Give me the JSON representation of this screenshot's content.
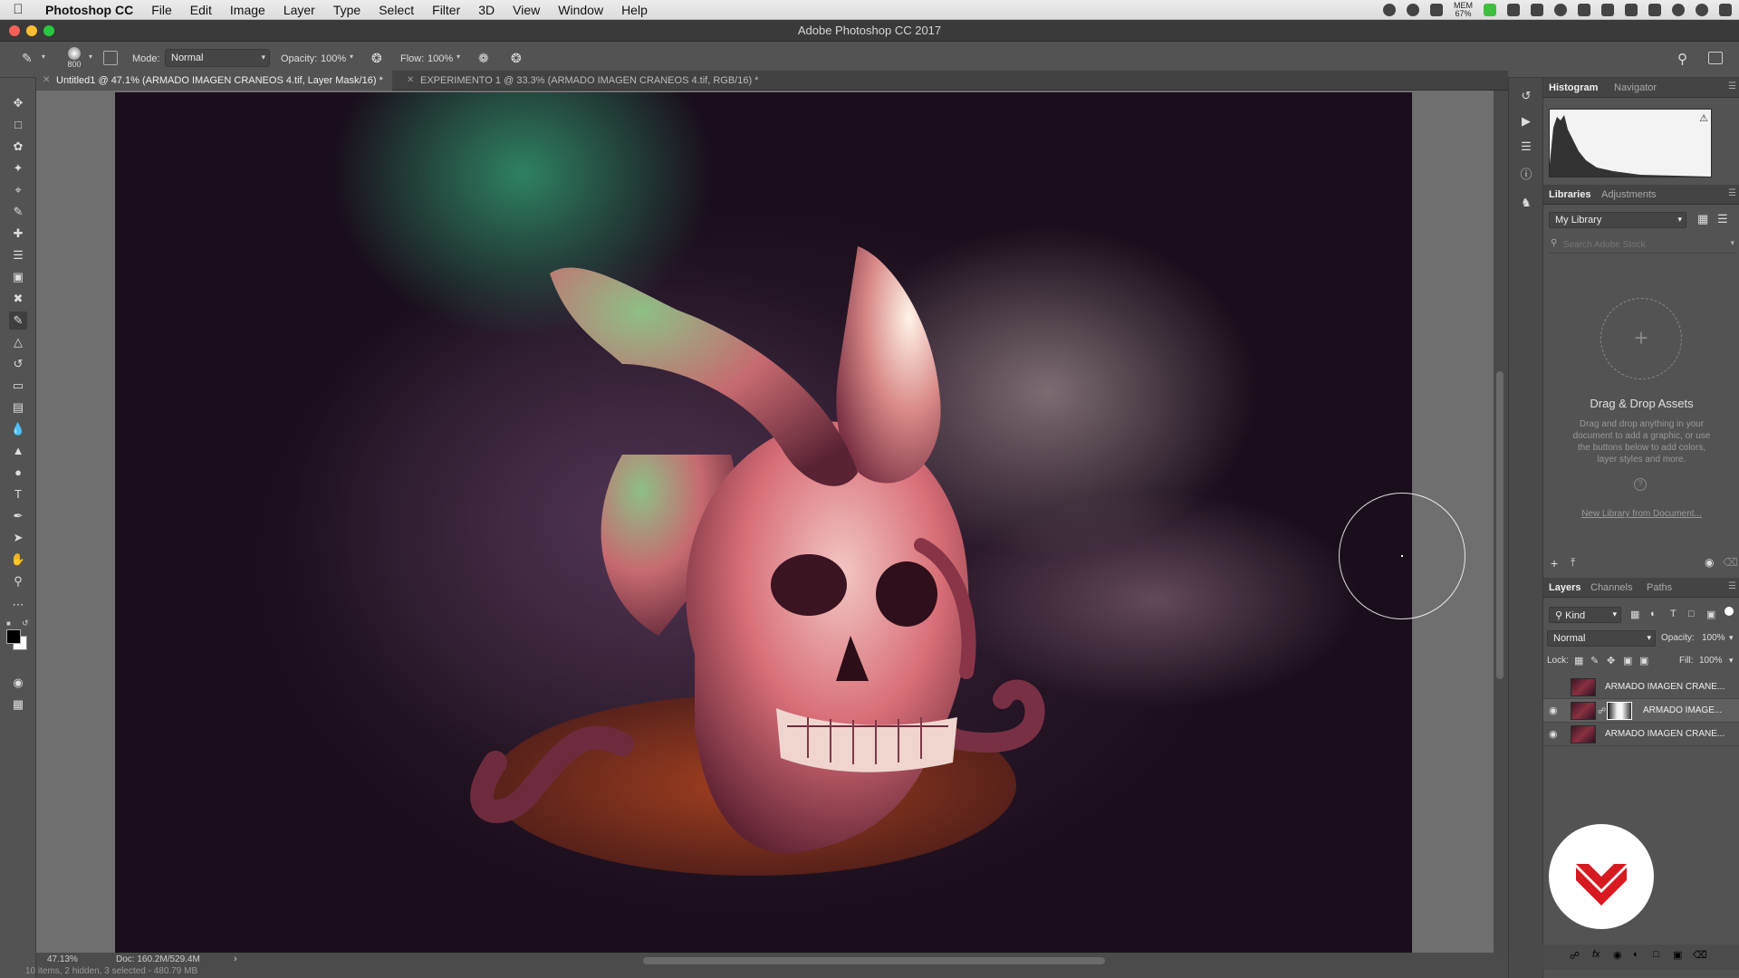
{
  "menubar": {
    "app_name": "Photoshop CC",
    "items": [
      "File",
      "Edit",
      "Image",
      "Layer",
      "Type",
      "Select",
      "Filter",
      "3D",
      "View",
      "Window",
      "Help"
    ],
    "mem_label": "MEM",
    "mem_value": "67%"
  },
  "window": {
    "title": "Adobe Photoshop CC 2017"
  },
  "options": {
    "brush_size": "800",
    "mode_label": "Mode:",
    "mode_value": "Normal",
    "opacity_label": "Opacity:",
    "opacity_value": "100%",
    "flow_label": "Flow:",
    "flow_value": "100%"
  },
  "tabs": [
    {
      "label": "Untitled1 @ 47.1% (ARMADO IMAGEN CRANEOS 4.tif, Layer Mask/16) *",
      "active": true
    },
    {
      "label": "EXPERIMENTO 1 @ 33.3% (ARMADO IMAGEN CRANEOS 4.tif, RGB/16) *",
      "active": false
    }
  ],
  "status": {
    "zoom": "47.13%",
    "doc": "Doc: 160.2M/529.4M",
    "items": "10 items, 2 hidden, 3 selected - 480.79 MB"
  },
  "histogram_panel": {
    "tabs": [
      "Histogram",
      "Navigator"
    ]
  },
  "libraries_panel": {
    "tabs": [
      "Libraries",
      "Adjustments"
    ],
    "library_select": "My Library",
    "search_placeholder": "Search Adobe Stock",
    "drop_title": "Drag & Drop Assets",
    "drop_text": "Drag and drop anything in your document to add a graphic, or use the buttons below to add colors, layer styles and more.",
    "new_library_link": "New Library from Document..."
  },
  "layers_panel": {
    "tabs": [
      "Layers",
      "Channels",
      "Paths"
    ],
    "filter_kind": "Kind",
    "blend_mode": "Normal",
    "opacity_label": "Opacity:",
    "opacity_value": "100%",
    "lock_label": "Lock:",
    "fill_label": "Fill:",
    "fill_value": "100%",
    "layers": [
      {
        "name": "ARMADO IMAGEN CRANE...",
        "visible": false,
        "selected": false,
        "has_mask": false
      },
      {
        "name": "ARMADO IMAGE...",
        "visible": true,
        "selected": true,
        "has_mask": true
      },
      {
        "name": "ARMADO IMAGEN CRANE...",
        "visible": true,
        "selected": false,
        "has_mask": false
      }
    ]
  },
  "colors": {
    "accent_red": "#d71920",
    "panel_bg": "#535353",
    "canvas_bg": "#6f6f6f"
  }
}
